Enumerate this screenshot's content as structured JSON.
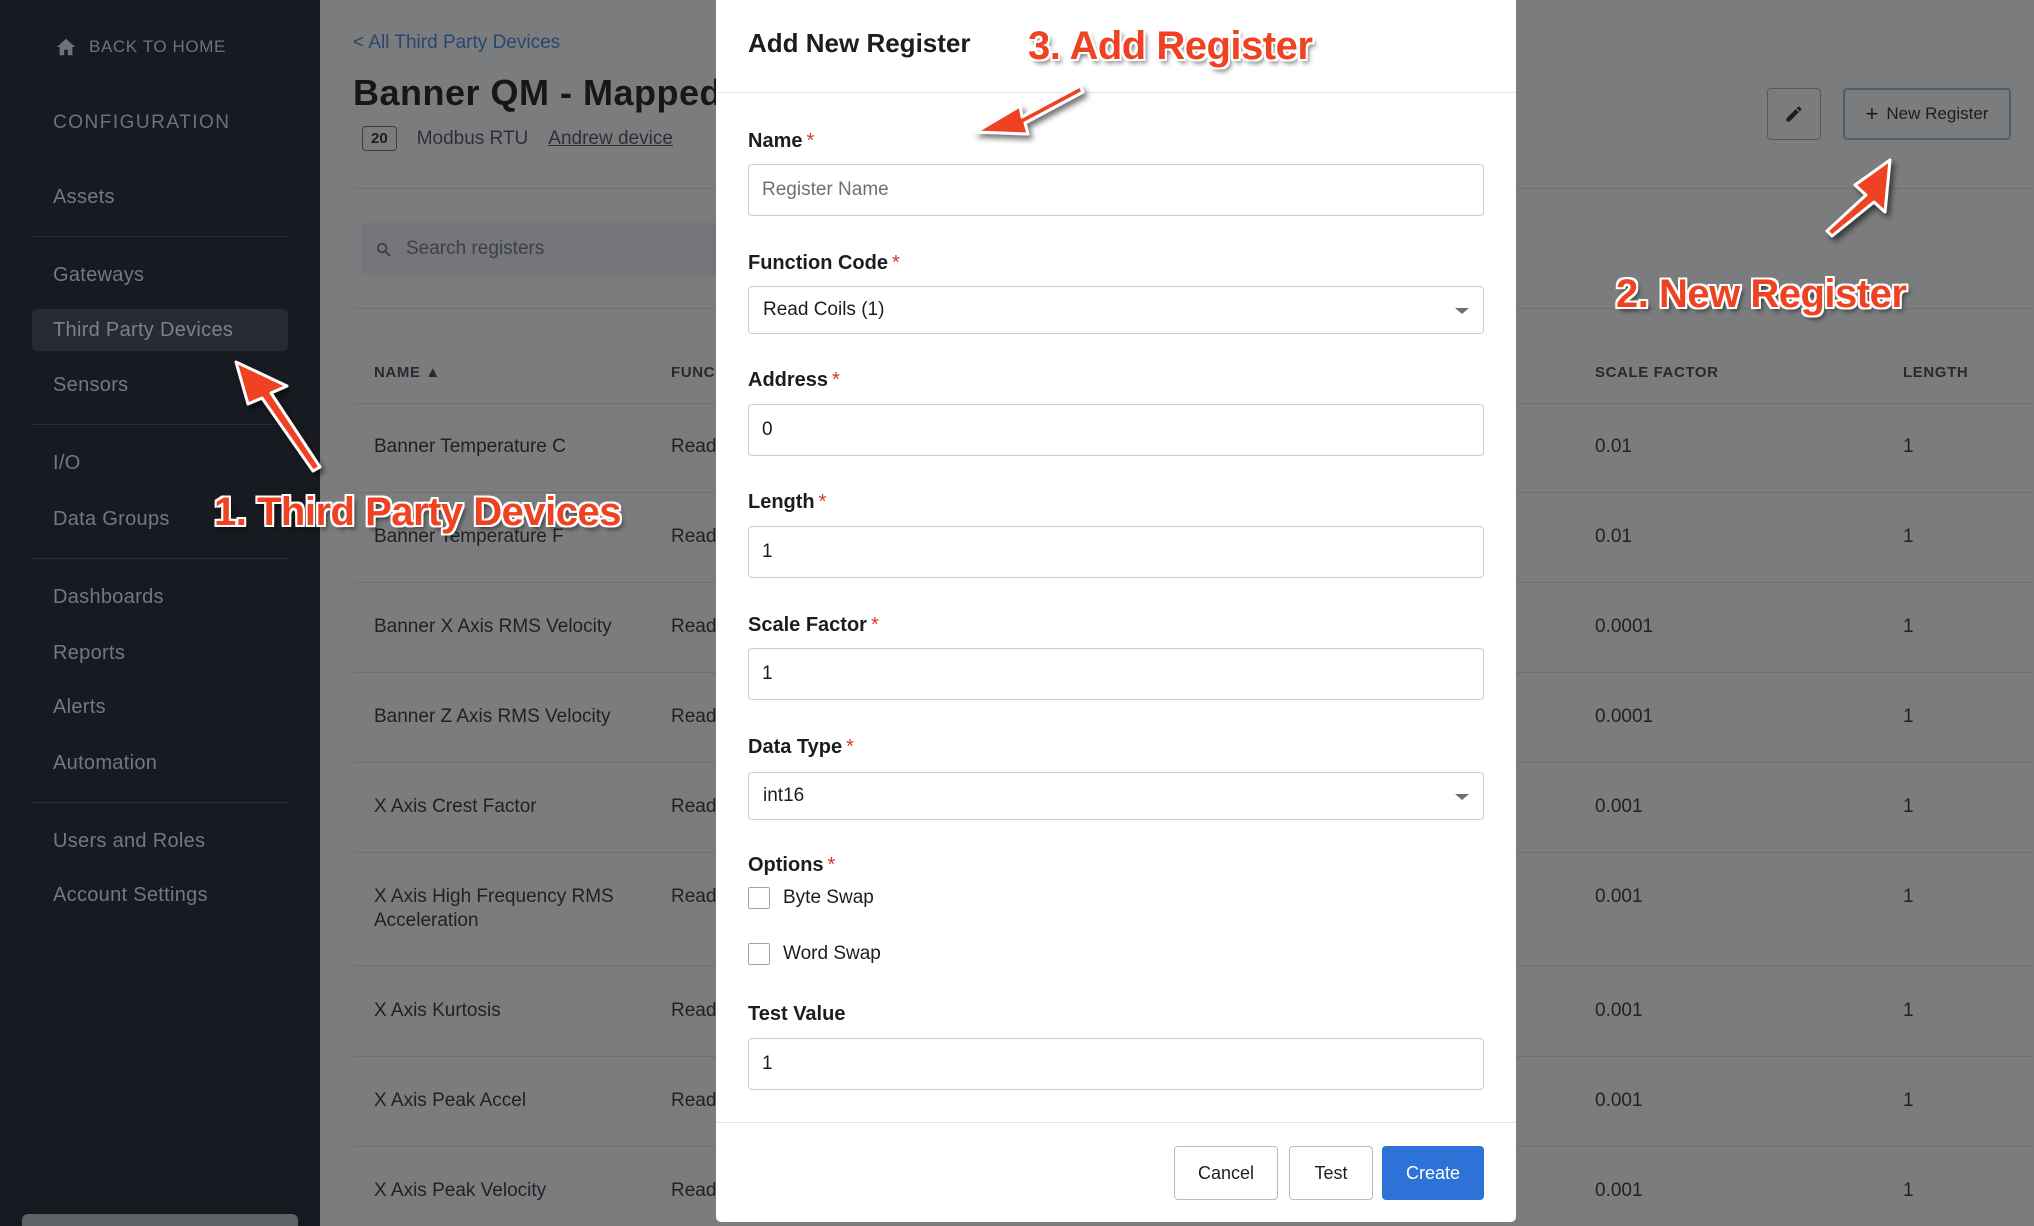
{
  "sidebar": {
    "back_label": "BACK TO HOME",
    "section_heading": "CONFIGURATION",
    "items": [
      {
        "label": "Assets"
      },
      {
        "label": "Gateways"
      },
      {
        "label": "Third Party Devices",
        "active": true
      },
      {
        "label": "Sensors"
      },
      {
        "label": "I/O"
      },
      {
        "label": "Data Groups"
      },
      {
        "label": "Dashboards"
      },
      {
        "label": "Reports"
      },
      {
        "label": "Alerts"
      },
      {
        "label": "Automation"
      },
      {
        "label": "Users and Roles"
      },
      {
        "label": "Account Settings"
      }
    ]
  },
  "page": {
    "breadcrumb": "< All Third Party Devices",
    "title": "Banner QM - Mapped",
    "badge": "20",
    "protocol": "Modbus RTU",
    "device_link": "Andrew device",
    "new_register_label": "New Register",
    "search_placeholder": "Search registers",
    "columns": {
      "name": "NAME ▲",
      "function": "FUNC",
      "scale_factor": "SCALE FACTOR",
      "length": "LENGTH"
    },
    "rows": [
      {
        "name": "Banner Temperature C",
        "function": "Read",
        "scale_factor": "0.01",
        "length": "1"
      },
      {
        "name": "Banner Temperature F",
        "function": "Read",
        "scale_factor": "0.01",
        "length": "1"
      },
      {
        "name": "Banner X Axis RMS Velocity",
        "function": "Read",
        "scale_factor": "0.0001",
        "length": "1"
      },
      {
        "name": "Banner Z Axis RMS Velocity",
        "function": "Read",
        "scale_factor": "0.0001",
        "length": "1"
      },
      {
        "name": "X Axis Crest Factor",
        "function": "Read",
        "scale_factor": "0.001",
        "length": "1"
      },
      {
        "name": "X Axis High Frequency RMS",
        "name_line2": "Acceleration",
        "function": "Read",
        "scale_factor": "0.001",
        "length": "1"
      },
      {
        "name": "X Axis Kurtosis",
        "function": "Read",
        "scale_factor": "0.001",
        "length": "1"
      },
      {
        "name": "X Axis Peak Accel",
        "function": "Read",
        "scale_factor": "0.001",
        "length": "1"
      },
      {
        "name": "X Axis Peak Velocity",
        "function": "Read",
        "scale_factor": "0.001",
        "length": "1"
      }
    ]
  },
  "modal": {
    "title": "Add New Register",
    "required_mark": "*",
    "name": {
      "label": "Name",
      "placeholder": "Register Name",
      "value": ""
    },
    "function_code": {
      "label": "Function Code",
      "value": "Read Coils (1)"
    },
    "address": {
      "label": "Address",
      "value": "0"
    },
    "length": {
      "label": "Length",
      "value": "1"
    },
    "scale_factor": {
      "label": "Scale Factor",
      "value": "1"
    },
    "data_type": {
      "label": "Data Type",
      "value": "int16"
    },
    "options": {
      "label": "Options",
      "byte_swap": "Byte Swap",
      "word_swap": "Word Swap",
      "byte_swap_checked": false,
      "word_swap_checked": false
    },
    "test_value": {
      "label": "Test Value",
      "value": "1"
    },
    "buttons": {
      "cancel": "Cancel",
      "test": "Test",
      "create": "Create"
    }
  },
  "annotations": {
    "step1": "1. Third Party Devices",
    "step2": "2. New Register",
    "step3": "3. Add Register"
  },
  "colors": {
    "annotation_red": "#ef4222",
    "primary_button": "#2d73d7",
    "sidebar_bg": "#171b21",
    "overlay_bg": "#7b7c7e"
  }
}
